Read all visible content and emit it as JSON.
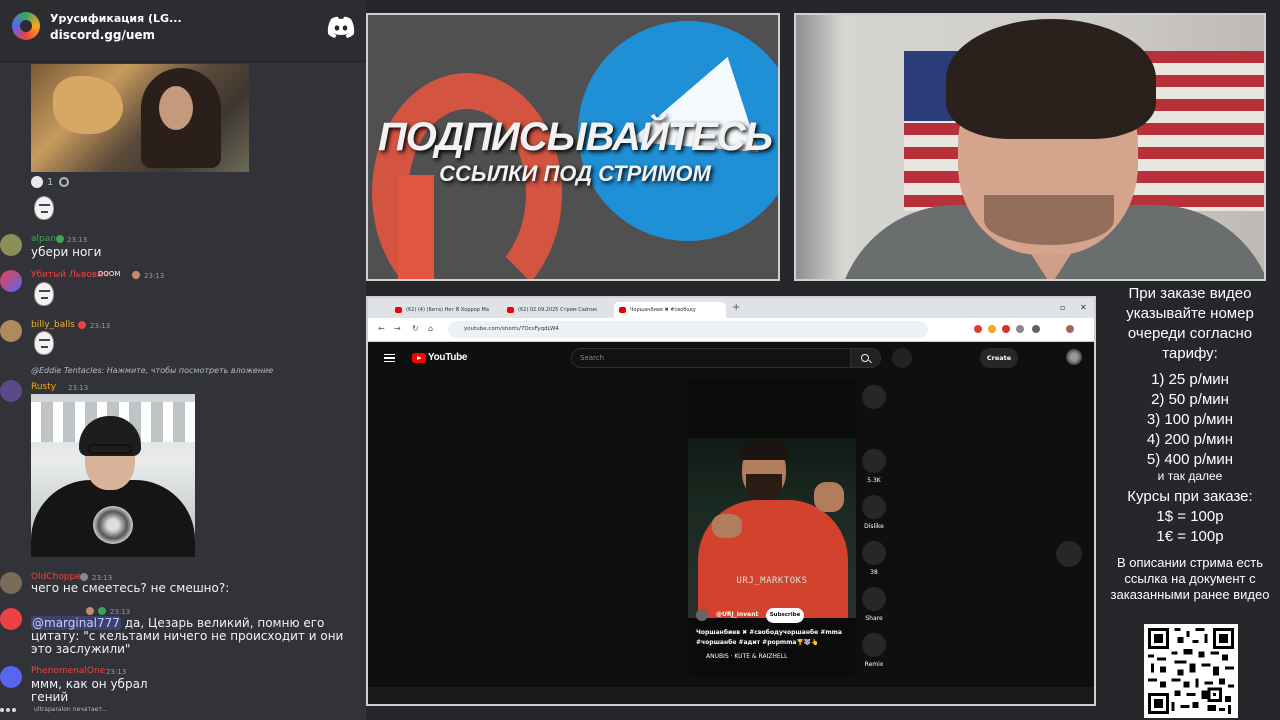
{
  "discord": {
    "server_name": "Урусификация (LG...",
    "invite": "discord.gg/uem",
    "reaction_count": "1",
    "messages": [
      {
        "user": "alpan",
        "time": "23:13",
        "text": "убери ноги",
        "color": "#3ba55c"
      },
      {
        "user": "Убитый Львович",
        "tag": "DOOM",
        "time": "23:13",
        "color": "#ed4245"
      },
      {
        "user": "billy_balls",
        "time": "23:13",
        "color": "#f0b232"
      },
      {
        "user": "Rusty",
        "time": "23:13",
        "color": "#faa61a",
        "reply": "@Eddie Tentacles: Нажмите, чтобы посмотреть вложение"
      },
      {
        "user": "OldChopper",
        "time": "23:13",
        "text": "чего не смеетесь? не смешно?:",
        "color": "#ed4245"
      },
      {
        "mention": "@marginal777",
        "time": "23:13",
        "text": " да, Цезарь великий, помню его цитату: \"с кельтами ничего не происходит и они это заслужили\""
      },
      {
        "user": "PhenomenalOne",
        "time": "23:13",
        "text": "ммм, как он убрал гений",
        "color": "#ed4245"
      }
    ],
    "typing": "ultraparalon печатает..."
  },
  "banner": {
    "title": "ПОДПИСЫВАЙТЕСЬ",
    "subtitle": "ССЫЛКИ ПОД СТРИМОМ"
  },
  "browser": {
    "tabs": [
      "(62) (4) (Бета) Нет В Хоррор Ма",
      "(62) 02.09.2025 Стрим Сайтик",
      "Чоршанбиев ✖ #свободу"
    ],
    "url": "youtube.com/shorts/7OcsFyqdLW4",
    "youtube": {
      "logo": "YouTube",
      "search_placeholder": "Search",
      "create_label": "Create",
      "channel": "@URJ_Invent",
      "subscribe": "Subscribe",
      "watermark": "URJ_MARKTOKS",
      "caption": "Чоршанбиев ✖ #свободучоршанбе #mma #чоршанбе #адит #popmma🏆🐺👆",
      "music": "ANUBIS · KUTE & RAIZHELL",
      "actions": [
        {
          "label": ""
        },
        {
          "label": "5.3K"
        },
        {
          "label": "Dislike"
        },
        {
          "label": "38"
        },
        {
          "label": "Share"
        },
        {
          "label": "Remix"
        }
      ]
    }
  },
  "info": {
    "order_note": "При заказе видео указывайте номер очереди согласно тарифу:",
    "tariffs": [
      "1) 25 р/мин",
      "2) 50 р/мин",
      "3) 100 р/мин",
      "4) 200 р/мин",
      "5) 400 р/мин"
    ],
    "etc": "и так далее",
    "rates_title": "Курсы при заказе:",
    "rates": [
      "1$ = 100р",
      "1€ = 100р"
    ],
    "doc_note": "В описании стрима есть ссылка на документ с заказанными ранее видео"
  }
}
